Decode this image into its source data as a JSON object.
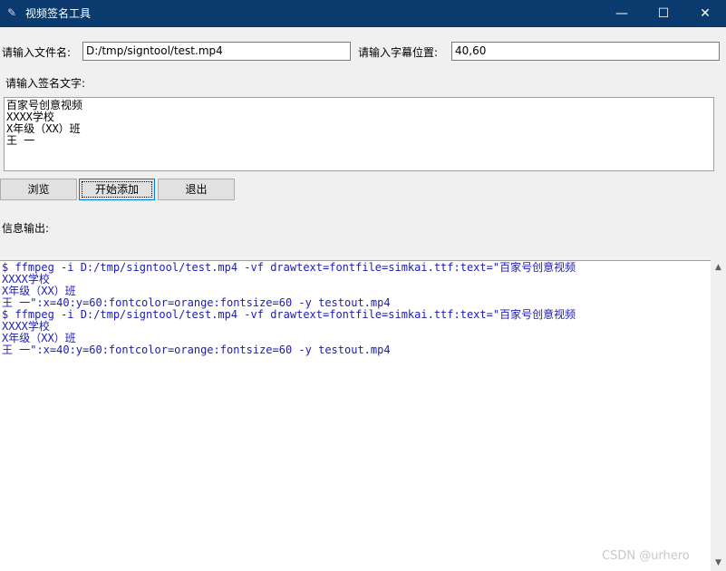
{
  "window": {
    "title": "视频签名工具",
    "icon": "feather-icon"
  },
  "titlebar_buttons": {
    "minimize": "—",
    "maximize": "☐",
    "close": "✕"
  },
  "form": {
    "filename_label": "请输入文件名:",
    "filename_value": "D:/tmp/signtool/test.mp4",
    "position_label": "请输入字幕位置:",
    "position_value": "40,60",
    "sign_label": "请输入签名文字:",
    "sign_text": "百家号创意视频\nXXXX学校\nX年级（XX）班\n王 一"
  },
  "buttons": {
    "browse": "浏览",
    "start": "开始添加",
    "exit": "退出"
  },
  "output": {
    "label": "信息输出:",
    "text": "$ ffmpeg -i D:/tmp/signtool/test.mp4 -vf drawtext=fontfile=simkai.ttf:text=\"百家号创意视频\nXXXX学校\nX年级（XX）班\n王 一\":x=40:y=60:fontcolor=orange:fontsize=60 -y testout.mp4\n$ ffmpeg -i D:/tmp/signtool/test.mp4 -vf drawtext=fontfile=simkai.ttf:text=\"百家号创意视频\nXXXX学校\nX年级（XX）班\n王 一\":x=40:y=60:fontcolor=orange:fontsize=60 -y testout.mp4",
    "text_color": "#1c1cb4"
  },
  "scrollbar": {
    "up": "▲",
    "down": "▼"
  },
  "watermark": "CSDN @urhero"
}
